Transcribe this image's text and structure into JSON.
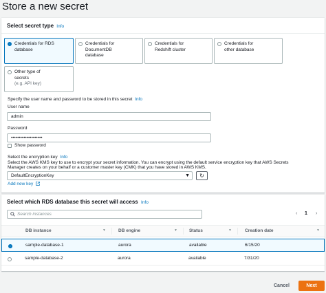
{
  "page": {
    "title": "Store a new secret"
  },
  "secret_type": {
    "header": "Select secret type",
    "info": "Info",
    "options": [
      {
        "line1": "Credentials for RDS",
        "line2": "database",
        "line3": "",
        "selected": true
      },
      {
        "line1": "Credentials for",
        "line2": "DocumentDB",
        "line3": "database",
        "selected": false
      },
      {
        "line1": "Credentials for",
        "line2": "Redshift cluster",
        "line3": "",
        "selected": false
      },
      {
        "line1": "Credentials for",
        "line2": "other database",
        "line3": "",
        "selected": false
      },
      {
        "line1": "Other type of",
        "line2": "secrets",
        "line3": "(e.g. API key)",
        "selected": false
      }
    ]
  },
  "credentials": {
    "description": "Specify the user name and password to be stored in this secret",
    "info": "Info",
    "username_label": "User name",
    "username_value": "admin",
    "password_label": "Password",
    "password_value": "••••••••••••••••••••",
    "show_password_label": "Show password"
  },
  "encryption": {
    "label": "Select the encryption key",
    "info": "Info",
    "desc_line1": "Select the AWS KMS key to use to encrypt your secret information. You can encrypt using the default service encryption key that AWS Secrets",
    "desc_line2": "Manager creates on your behalf or a customer master key (CMK) that you have stored in AWS KMS.",
    "selected_key": "DefaultEncryptionKey",
    "add_new_key": "Add new key"
  },
  "database": {
    "header": "Select which RDS database this secret will access",
    "info": "Info",
    "search_placeholder": "Search instances",
    "page_number": "1",
    "columns": [
      "DB instance",
      "DB engine",
      "Status",
      "Creation date"
    ],
    "rows": [
      {
        "instance": "sample-database-1",
        "engine": "aurora",
        "status": "available",
        "created": "6/15/20",
        "selected": true
      },
      {
        "instance": "sample-database-2",
        "engine": "aurora",
        "status": "available",
        "created": "7/31/20",
        "selected": false
      }
    ]
  },
  "footer": {
    "cancel": "Cancel",
    "next": "Next"
  },
  "colors": {
    "accent": "#0073bb",
    "primary_button": "#ec7211"
  }
}
